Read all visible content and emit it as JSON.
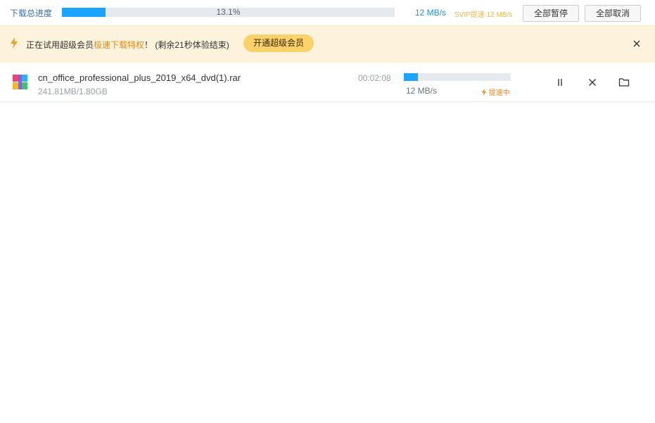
{
  "header": {
    "total_label": "下载总进度",
    "total_percent_text": "13.1%",
    "total_progress": 0.131,
    "speed": "12 MB/s",
    "svip_speed": "SVIP提速 12 MB/s",
    "pause_all_label": "全部暂停",
    "cancel_all_label": "全部取消"
  },
  "banner": {
    "text_before": "正在试用超级会员",
    "text_highlight": "极速下载特权",
    "text_after": "！ (剩余21秒体验结束)",
    "vip_button_label": "开通超级会员"
  },
  "downloads": [
    {
      "file_name": "cn_office_professional_plus_2019_x64_dvd(1).rar",
      "size_text": "241.81MB/1.80GB",
      "eta": "00:02:08",
      "progress": 0.131,
      "speed": "12 MB/s",
      "accel_label": "提速中"
    }
  ],
  "colors": {
    "accent": "#1aa3ff",
    "banner_bg": "#fdf3dc",
    "highlight": "#e98a19",
    "vip_button": "#fbd26a"
  }
}
